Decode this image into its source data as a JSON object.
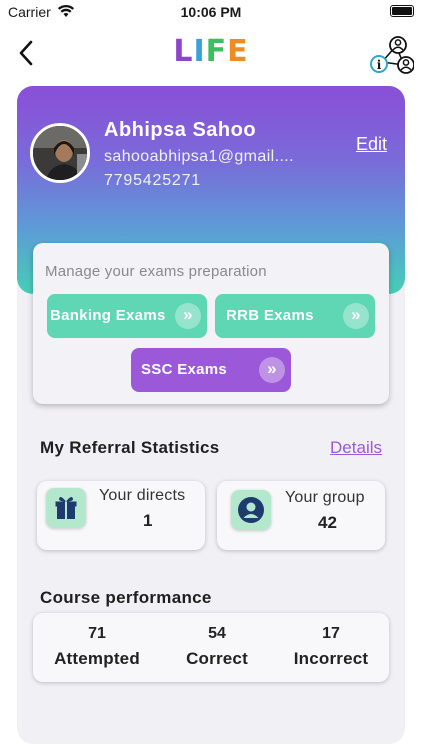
{
  "status_bar": {
    "carrier": "Carrier",
    "time": "10:06 PM"
  },
  "nav": {
    "logo_letters": [
      "L",
      "I",
      "F",
      "E"
    ],
    "logo_colors": [
      "#8e44c9",
      "#3aa0d8",
      "#3cbf5f",
      "#f08a24"
    ]
  },
  "profile": {
    "name": "Abhipsa Sahoo",
    "email": "sahooabhipsa1@gmail....",
    "phone": "7795425271",
    "edit_label": "Edit"
  },
  "exams": {
    "title": "Manage your exams preparation",
    "buttons": [
      {
        "label": "Banking Exams",
        "color": "#5fd6b4"
      },
      {
        "label": "RRB Exams",
        "color": "#5fd6b4"
      },
      {
        "label": "SSC Exams",
        "color": "#9b59d9"
      }
    ]
  },
  "referral": {
    "title": "My Referral Statistics",
    "details_label": "Details",
    "directs": {
      "label": "Your directs",
      "value": "1",
      "icon": "gift-icon"
    },
    "group": {
      "label": "Your group",
      "value": "42",
      "icon": "user-icon"
    }
  },
  "performance": {
    "title": "Course performance",
    "items": [
      {
        "value": "71",
        "label": "Attempted"
      },
      {
        "value": "54",
        "label": "Correct"
      },
      {
        "value": "17",
        "label": "Incorrect"
      }
    ]
  }
}
